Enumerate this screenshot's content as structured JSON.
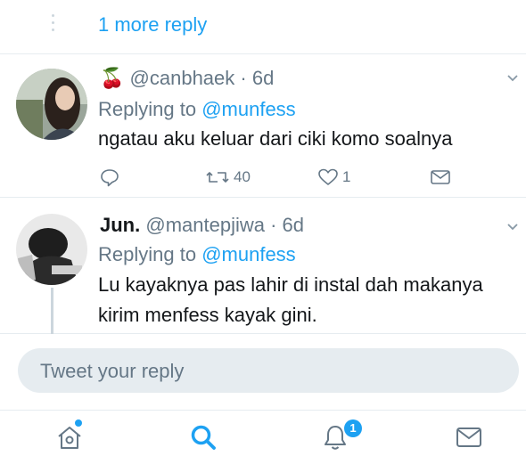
{
  "thread": {
    "more_replies_label": "1 more reply"
  },
  "tweets": [
    {
      "emoji": "🍒",
      "display_name": "",
      "handle": "@canbhaek",
      "time": "· 6d",
      "replying_prefix": "Replying to",
      "replying_to": "@munfess",
      "text_lines": [
        "ngatau aku keluar dari ciki komo soalnya"
      ],
      "retweets": "40",
      "likes": "1"
    },
    {
      "emoji": "",
      "display_name": "Jun.",
      "handle": "@mantepjiwa",
      "time": "· 6d",
      "replying_prefix": "Replying to",
      "replying_to": "@munfess",
      "text_lines": [
        "Lu kayaknya pas lahir di instal dah makanya",
        "kirim menfess kayak gini."
      ]
    }
  ],
  "compose": {
    "placeholder": "Tweet your reply"
  },
  "tabbar": {
    "notifications_badge": "1",
    "items": [
      "home-icon",
      "search-icon",
      "notifications-icon",
      "messages-icon"
    ]
  },
  "colors": {
    "accent": "#1da1f2",
    "muted": "#657786",
    "divider": "#e6ecf0"
  }
}
